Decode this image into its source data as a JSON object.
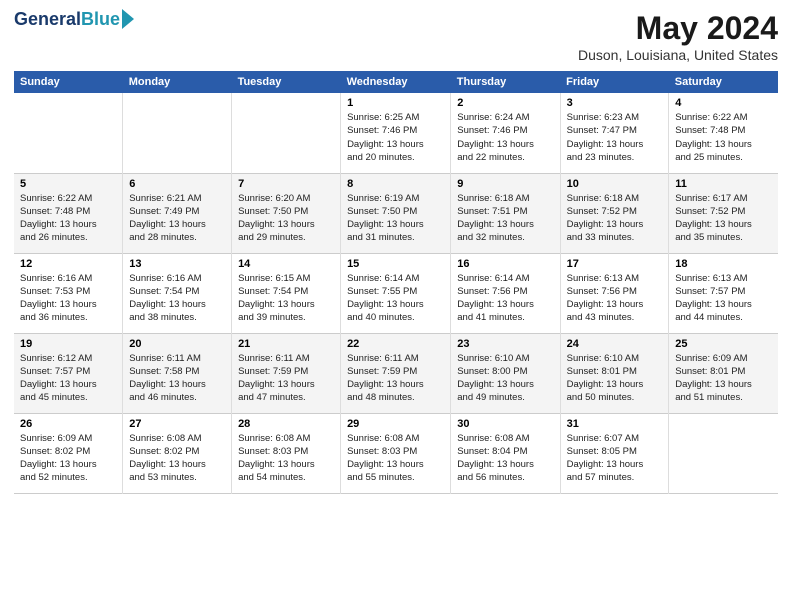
{
  "header": {
    "logo_line1": "General",
    "logo_line2": "Blue",
    "month_title": "May 2024",
    "location": "Duson, Louisiana, United States"
  },
  "days_of_week": [
    "Sunday",
    "Monday",
    "Tuesday",
    "Wednesday",
    "Thursday",
    "Friday",
    "Saturday"
  ],
  "weeks": [
    [
      {
        "day": "",
        "info": ""
      },
      {
        "day": "",
        "info": ""
      },
      {
        "day": "",
        "info": ""
      },
      {
        "day": "1",
        "info": "Sunrise: 6:25 AM\nSunset: 7:46 PM\nDaylight: 13 hours\nand 20 minutes."
      },
      {
        "day": "2",
        "info": "Sunrise: 6:24 AM\nSunset: 7:46 PM\nDaylight: 13 hours\nand 22 minutes."
      },
      {
        "day": "3",
        "info": "Sunrise: 6:23 AM\nSunset: 7:47 PM\nDaylight: 13 hours\nand 23 minutes."
      },
      {
        "day": "4",
        "info": "Sunrise: 6:22 AM\nSunset: 7:48 PM\nDaylight: 13 hours\nand 25 minutes."
      }
    ],
    [
      {
        "day": "5",
        "info": "Sunrise: 6:22 AM\nSunset: 7:48 PM\nDaylight: 13 hours\nand 26 minutes."
      },
      {
        "day": "6",
        "info": "Sunrise: 6:21 AM\nSunset: 7:49 PM\nDaylight: 13 hours\nand 28 minutes."
      },
      {
        "day": "7",
        "info": "Sunrise: 6:20 AM\nSunset: 7:50 PM\nDaylight: 13 hours\nand 29 minutes."
      },
      {
        "day": "8",
        "info": "Sunrise: 6:19 AM\nSunset: 7:50 PM\nDaylight: 13 hours\nand 31 minutes."
      },
      {
        "day": "9",
        "info": "Sunrise: 6:18 AM\nSunset: 7:51 PM\nDaylight: 13 hours\nand 32 minutes."
      },
      {
        "day": "10",
        "info": "Sunrise: 6:18 AM\nSunset: 7:52 PM\nDaylight: 13 hours\nand 33 minutes."
      },
      {
        "day": "11",
        "info": "Sunrise: 6:17 AM\nSunset: 7:52 PM\nDaylight: 13 hours\nand 35 minutes."
      }
    ],
    [
      {
        "day": "12",
        "info": "Sunrise: 6:16 AM\nSunset: 7:53 PM\nDaylight: 13 hours\nand 36 minutes."
      },
      {
        "day": "13",
        "info": "Sunrise: 6:16 AM\nSunset: 7:54 PM\nDaylight: 13 hours\nand 38 minutes."
      },
      {
        "day": "14",
        "info": "Sunrise: 6:15 AM\nSunset: 7:54 PM\nDaylight: 13 hours\nand 39 minutes."
      },
      {
        "day": "15",
        "info": "Sunrise: 6:14 AM\nSunset: 7:55 PM\nDaylight: 13 hours\nand 40 minutes."
      },
      {
        "day": "16",
        "info": "Sunrise: 6:14 AM\nSunset: 7:56 PM\nDaylight: 13 hours\nand 41 minutes."
      },
      {
        "day": "17",
        "info": "Sunrise: 6:13 AM\nSunset: 7:56 PM\nDaylight: 13 hours\nand 43 minutes."
      },
      {
        "day": "18",
        "info": "Sunrise: 6:13 AM\nSunset: 7:57 PM\nDaylight: 13 hours\nand 44 minutes."
      }
    ],
    [
      {
        "day": "19",
        "info": "Sunrise: 6:12 AM\nSunset: 7:57 PM\nDaylight: 13 hours\nand 45 minutes."
      },
      {
        "day": "20",
        "info": "Sunrise: 6:11 AM\nSunset: 7:58 PM\nDaylight: 13 hours\nand 46 minutes."
      },
      {
        "day": "21",
        "info": "Sunrise: 6:11 AM\nSunset: 7:59 PM\nDaylight: 13 hours\nand 47 minutes."
      },
      {
        "day": "22",
        "info": "Sunrise: 6:11 AM\nSunset: 7:59 PM\nDaylight: 13 hours\nand 48 minutes."
      },
      {
        "day": "23",
        "info": "Sunrise: 6:10 AM\nSunset: 8:00 PM\nDaylight: 13 hours\nand 49 minutes."
      },
      {
        "day": "24",
        "info": "Sunrise: 6:10 AM\nSunset: 8:01 PM\nDaylight: 13 hours\nand 50 minutes."
      },
      {
        "day": "25",
        "info": "Sunrise: 6:09 AM\nSunset: 8:01 PM\nDaylight: 13 hours\nand 51 minutes."
      }
    ],
    [
      {
        "day": "26",
        "info": "Sunrise: 6:09 AM\nSunset: 8:02 PM\nDaylight: 13 hours\nand 52 minutes."
      },
      {
        "day": "27",
        "info": "Sunrise: 6:08 AM\nSunset: 8:02 PM\nDaylight: 13 hours\nand 53 minutes."
      },
      {
        "day": "28",
        "info": "Sunrise: 6:08 AM\nSunset: 8:03 PM\nDaylight: 13 hours\nand 54 minutes."
      },
      {
        "day": "29",
        "info": "Sunrise: 6:08 AM\nSunset: 8:03 PM\nDaylight: 13 hours\nand 55 minutes."
      },
      {
        "day": "30",
        "info": "Sunrise: 6:08 AM\nSunset: 8:04 PM\nDaylight: 13 hours\nand 56 minutes."
      },
      {
        "day": "31",
        "info": "Sunrise: 6:07 AM\nSunset: 8:05 PM\nDaylight: 13 hours\nand 57 minutes."
      },
      {
        "day": "",
        "info": ""
      }
    ]
  ]
}
